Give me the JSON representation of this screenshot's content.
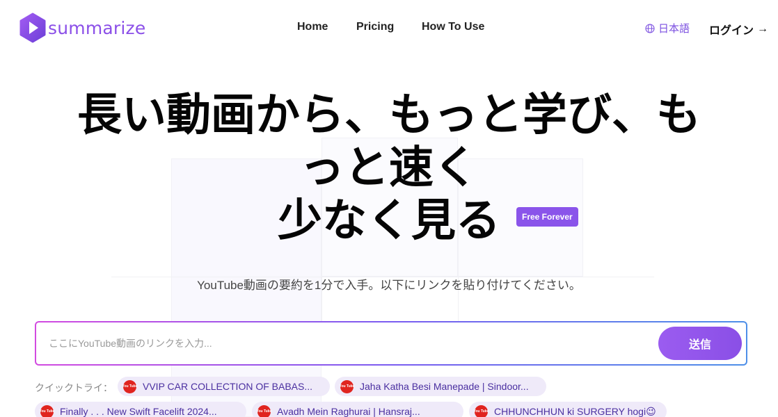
{
  "header": {
    "logo_text": "summarize",
    "nav": [
      {
        "label": "Home"
      },
      {
        "label": "Pricing"
      },
      {
        "label": "How To Use"
      }
    ],
    "language": "日本語",
    "login_label": "ログイン",
    "login_arrow": "→"
  },
  "hero": {
    "title_lines": [
      "長い動画から、もっと学び、も",
      "っと速く",
      "少なく見る"
    ],
    "badge": "Free Forever",
    "subtitle": "YouTube動画の要約を1分で入手。以下にリンクを貼り付けてください。"
  },
  "search": {
    "placeholder": "ここにYouTube動画のリンクを入力...",
    "value": "",
    "submit_label": "送信"
  },
  "quick_try": {
    "label": "クイックトライ：",
    "icon_text": "You Tube",
    "items": [
      {
        "label": "VVIP CAR COLLECTION OF BABAS..."
      },
      {
        "label": "Jaha Katha Besi Manepade | Sindoor..."
      },
      {
        "label": "Finally . . . New Swift Facelift 2024..."
      },
      {
        "label": "Avadh Mein Raghurai | Hansraj..."
      },
      {
        "label": "CHHUNCHHUN ki SURGERY hogi😉"
      }
    ]
  },
  "colors": {
    "brand": "#8b4fe8",
    "badge_bg": "#8a54ea",
    "chip_bg": "#efeaf9",
    "youtube_red": "#e0241f"
  },
  "icons": [
    "logo-play-icon",
    "globe-icon",
    "arrow-right-icon",
    "youtube-icon"
  ]
}
